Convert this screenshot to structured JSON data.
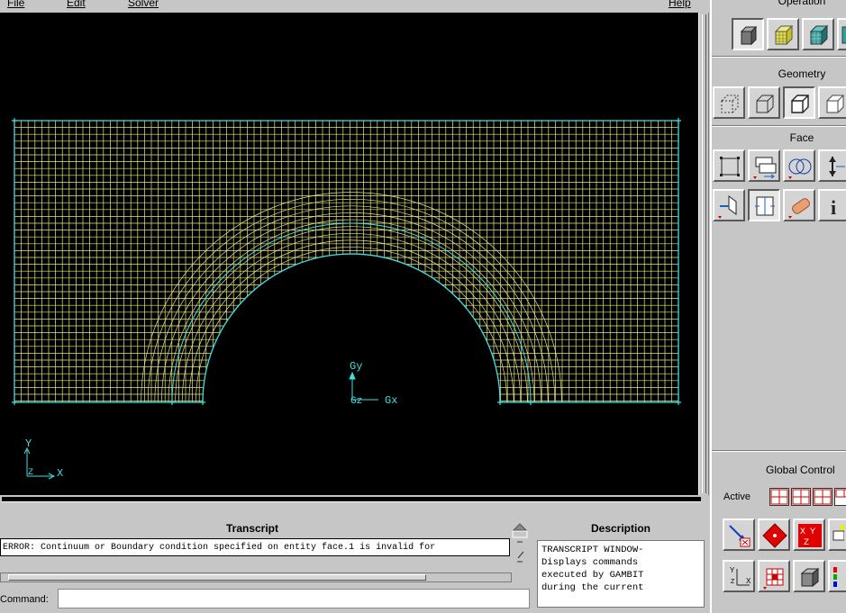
{
  "menubar": {
    "file": "File",
    "edit": "Edit",
    "solver": "Solver",
    "help": "Help"
  },
  "viewport": {
    "axis_gy": "Gy",
    "axis_gz": "Gz",
    "axis_gx": "Gx",
    "triad_y": "Y",
    "triad_z": "Z",
    "triad_x": "X",
    "mesh_color": "#e6e680",
    "edge_color": "#3fdfdf"
  },
  "transcript": {
    "title": "Transcript",
    "text": "ERROR: Continuum or Boundary condition specified on entity face.1 is invalid for"
  },
  "description": {
    "title": "Description",
    "text": "TRANSCRIPT WINDOW-\nDisplays commands\nexecuted by GAMBIT\nduring the current"
  },
  "command": {
    "label": "Command:",
    "value": ""
  },
  "toolpanel": {
    "operation_title": "Operation",
    "geometry_title": "Geometry",
    "face_title": "Face",
    "global_control_title": "Global Control",
    "active_label": "Active"
  }
}
